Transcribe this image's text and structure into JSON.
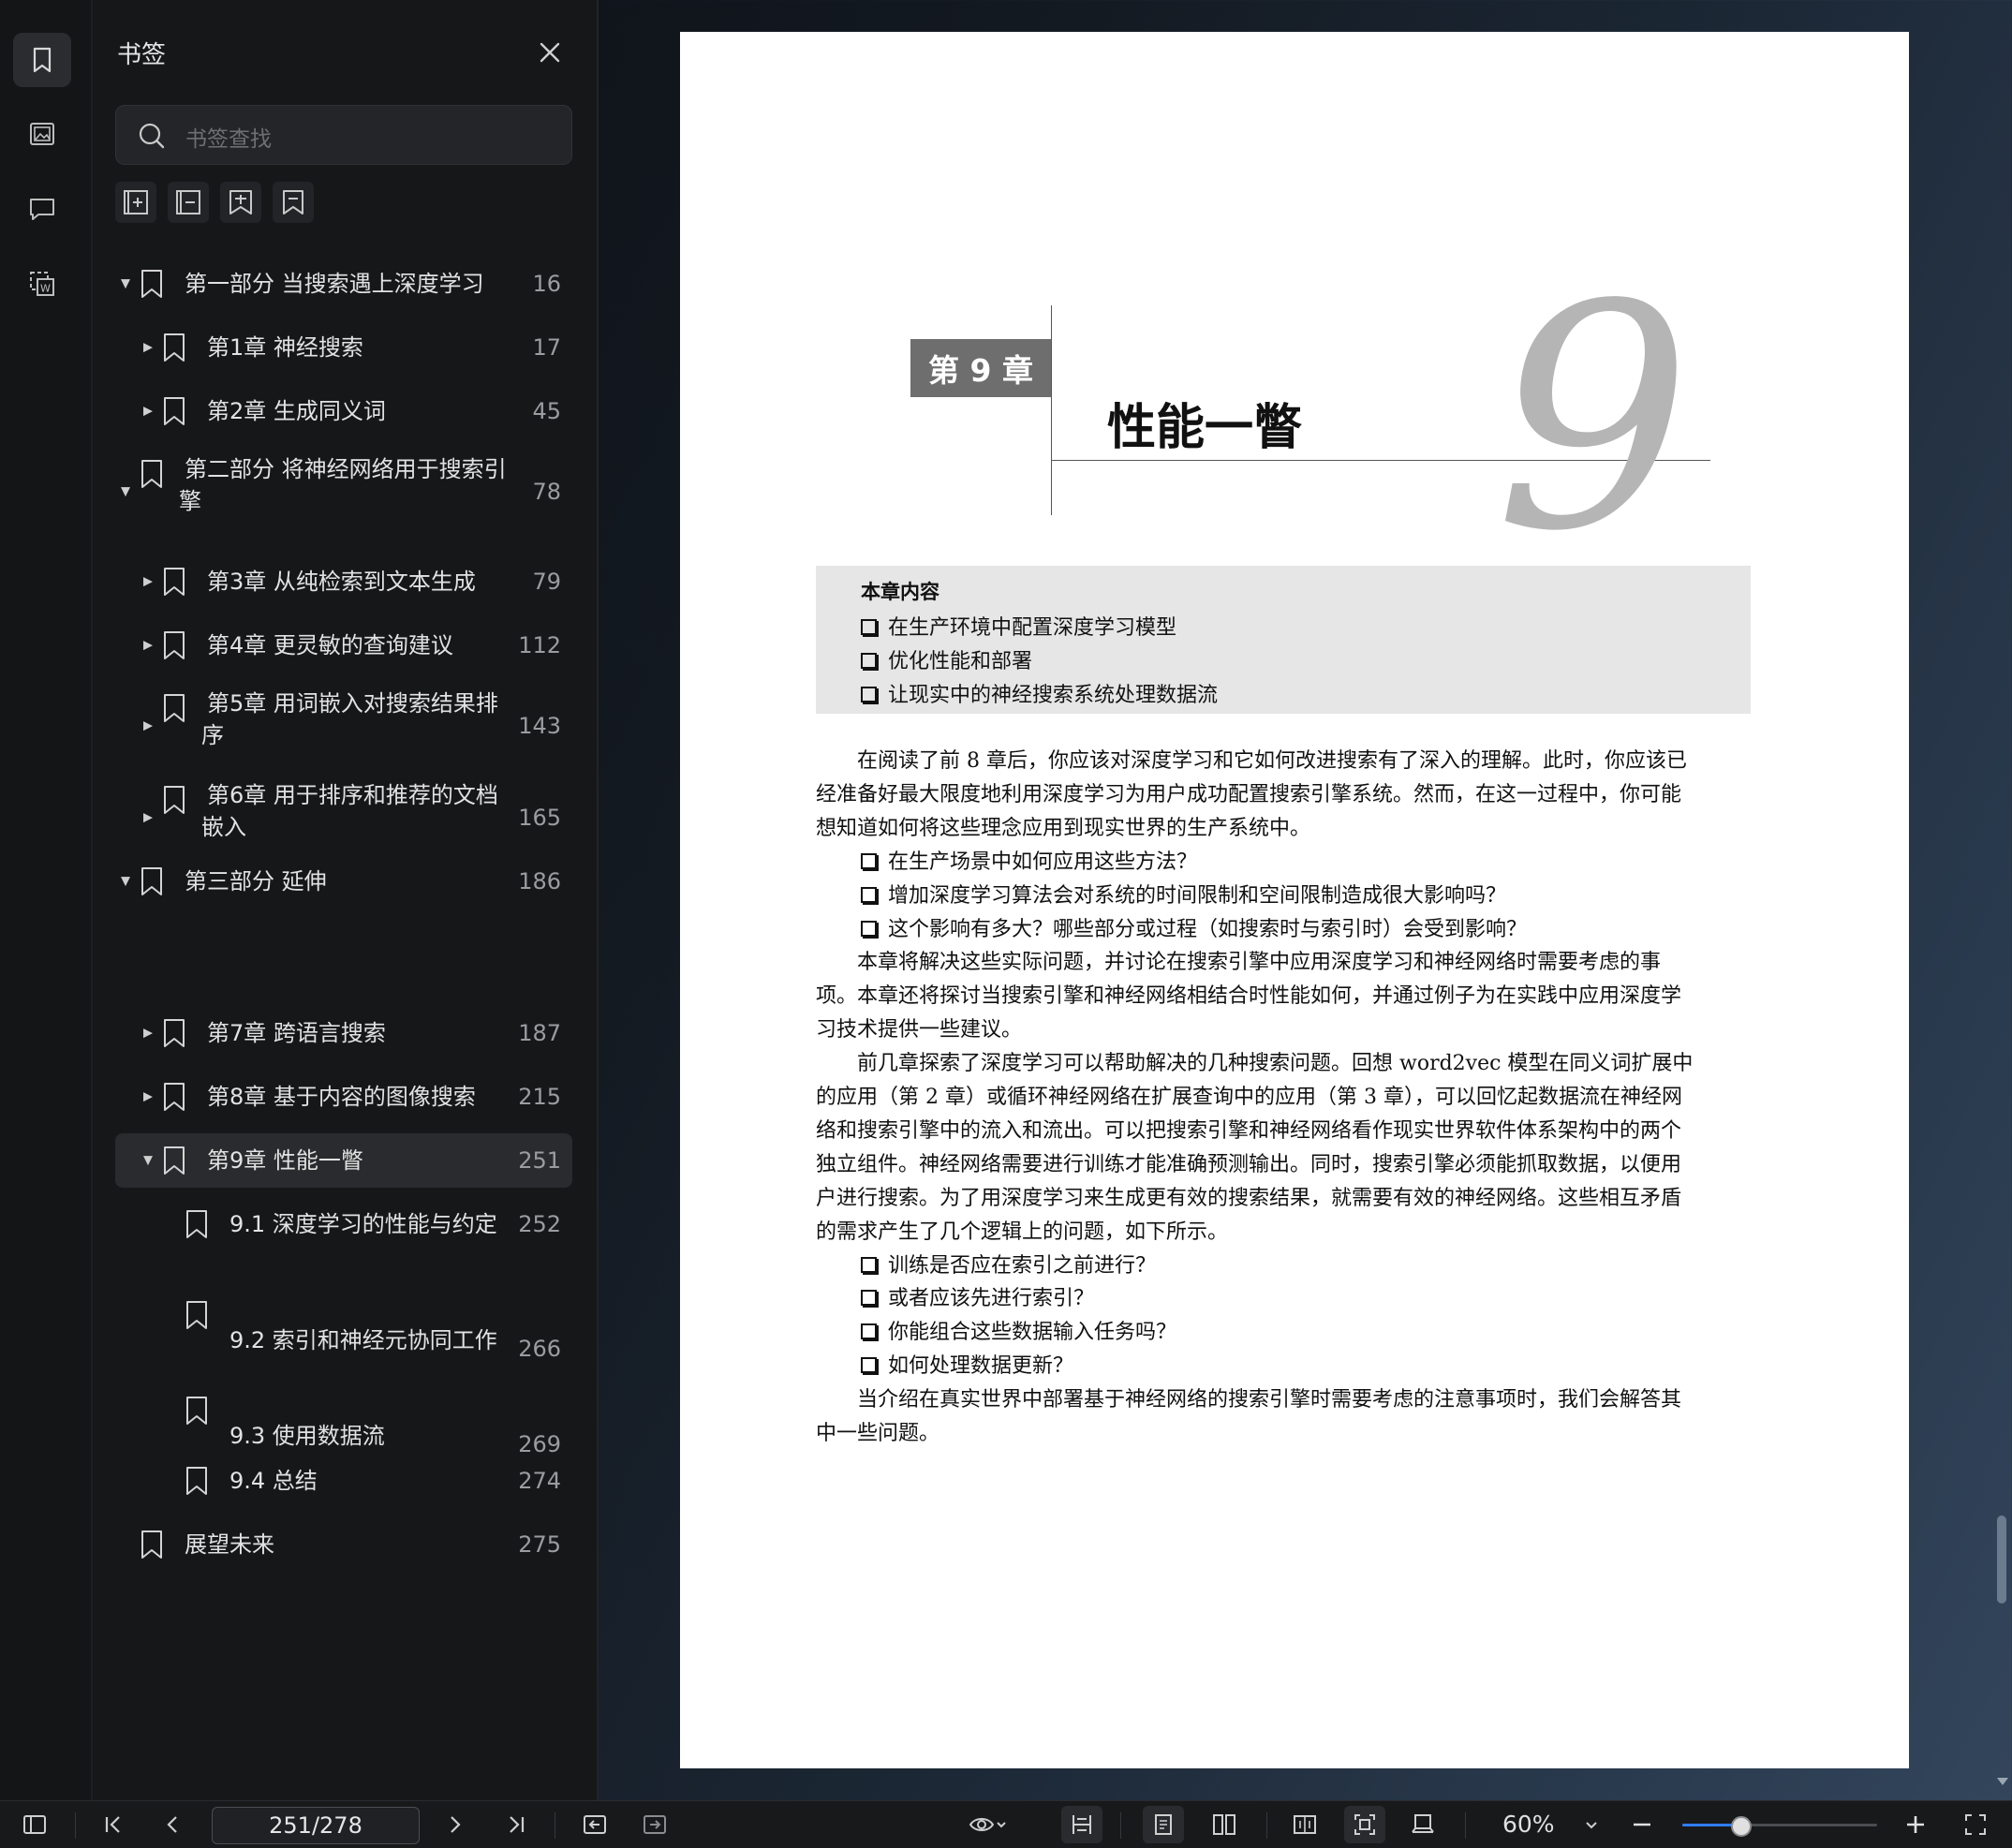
{
  "sidebar": {
    "title": "书签",
    "search_placeholder": "书签查找",
    "rail_icons": [
      "bookmark-icon",
      "image-icon",
      "comment-icon",
      "text-extract-icon"
    ],
    "tools": [
      "expand-all-icon",
      "collapse-all-icon",
      "add-bookmark-icon",
      "bookmark-ribbon-icon"
    ],
    "items": [
      {
        "label": "第一部分 当搜索遇上深度学习",
        "page": "16",
        "level": 0,
        "arrow": "▼"
      },
      {
        "label": "第1章 神经搜索",
        "page": "17",
        "level": 1,
        "arrow": "▶"
      },
      {
        "label": "第2章 生成同义词",
        "page": "45",
        "level": 1,
        "arrow": "▶"
      },
      {
        "label": "第二部分 将神经网络用于搜索引",
        "label2": "擎",
        "page": "78",
        "level": 0,
        "arrow": "▼"
      },
      {
        "label": "第3章 从纯检索到文本生成",
        "page": "79",
        "level": 1,
        "arrow": "▶"
      },
      {
        "label": "第4章 更灵敏的查询建议",
        "page": "112",
        "level": 1,
        "arrow": "▶"
      },
      {
        "label": "第5章 用词嵌入对搜索结果排",
        "label2": "序",
        "page": "143",
        "level": 1,
        "arrow": "▶"
      },
      {
        "label": "第6章 用于排序和推荐的文档",
        "label2": "嵌入",
        "page": "165",
        "level": 1,
        "arrow": "▶"
      },
      {
        "label": "第三部分 延伸",
        "page": "186",
        "level": 0,
        "arrow": "▼"
      },
      {
        "label": "第7章 跨语言搜索",
        "page": "187",
        "level": 1,
        "arrow": "▶"
      },
      {
        "label": "第8章 基于内容的图像搜索",
        "page": "215",
        "level": 1,
        "arrow": "▶"
      },
      {
        "label": "第9章 性能一瞥",
        "page": "251",
        "level": 1,
        "arrow": "▼",
        "selected": true
      },
      {
        "label": "9.1 深度学习的性能与约定",
        "page": "252",
        "level": 2
      },
      {
        "label": "9.2 索引和神经元协同工作",
        "page": "266",
        "level": 2
      },
      {
        "label": "9.3 使用数据流",
        "page": "269",
        "level": 2
      },
      {
        "label": "9.4 总结",
        "page": "274",
        "level": 2
      },
      {
        "label": "展望未来",
        "page": "275",
        "level": 0
      }
    ]
  },
  "document": {
    "chapter_label": "第 9 章",
    "chapter_title": "性能一瞥",
    "chapter_number": "9",
    "box_title": "本章内容",
    "box_items": [
      "在生产环境中配置深度学习模型",
      "优化性能和部署",
      "让现实中的神经搜索系统处理数据流"
    ],
    "lines": [
      "在阅读了前 8 章后，你应该对深度学习和它如何改进搜索有了深入的理解。此时，你应该已",
      "经准备好最大限度地利用深度学习为用户成功配置搜索引擎系统。然而，在这一过程中，你可能",
      "想知道如何将这些理念应用到现实世界的生产系统中。",
      "在生产场景中如何应用这些方法？",
      "增加深度学习算法会对系统的时间限制和空间限制造成很大影响吗？",
      "这个影响有多大？哪些部分或过程（如搜索时与索引时）会受到影响？",
      "本章将解决这些实际问题，并讨论在搜索引擎中应用深度学习和神经网络时需要考虑的事",
      "项。本章还将探讨当搜索引擎和神经网络相结合时性能如何，并通过例子为在实践中应用深度学",
      "习技术提供一些建议。",
      "前几章探索了深度学习可以帮助解决的几种搜索问题。回想 word2vec 模型在同义词扩展中",
      "的应用（第 2 章）或循环神经网络在扩展查询中的应用（第 3 章），可以回忆起数据流在神经网",
      "络和搜索引擎中的流入和流出。可以把搜索引擎和神经网络看作现实世界软件体系架构中的两个",
      "独立组件。神经网络需要进行训练才能准确预测输出。同时，搜索引擎必须能抓取数据，以便用",
      "户进行搜索。为了用深度学习来生成更有效的搜索结果，就需要有效的神经网络。这些相互矛盾",
      "的需求产生了几个逻辑上的问题，如下所示。",
      "训练是否应在索引之前进行？",
      "或者应该先进行索引？",
      "你能组合这些数据输入任务吗？",
      "如何处理数据更新？",
      "当介绍在真实世界中部署基于神经网络的搜索引擎时需要考虑的注意事项时，我们会解答其",
      "中一些问题。"
    ]
  },
  "toolbar": {
    "page_indicator": "251/278",
    "zoom": "60%",
    "zoom_level_fraction": 0.3
  }
}
